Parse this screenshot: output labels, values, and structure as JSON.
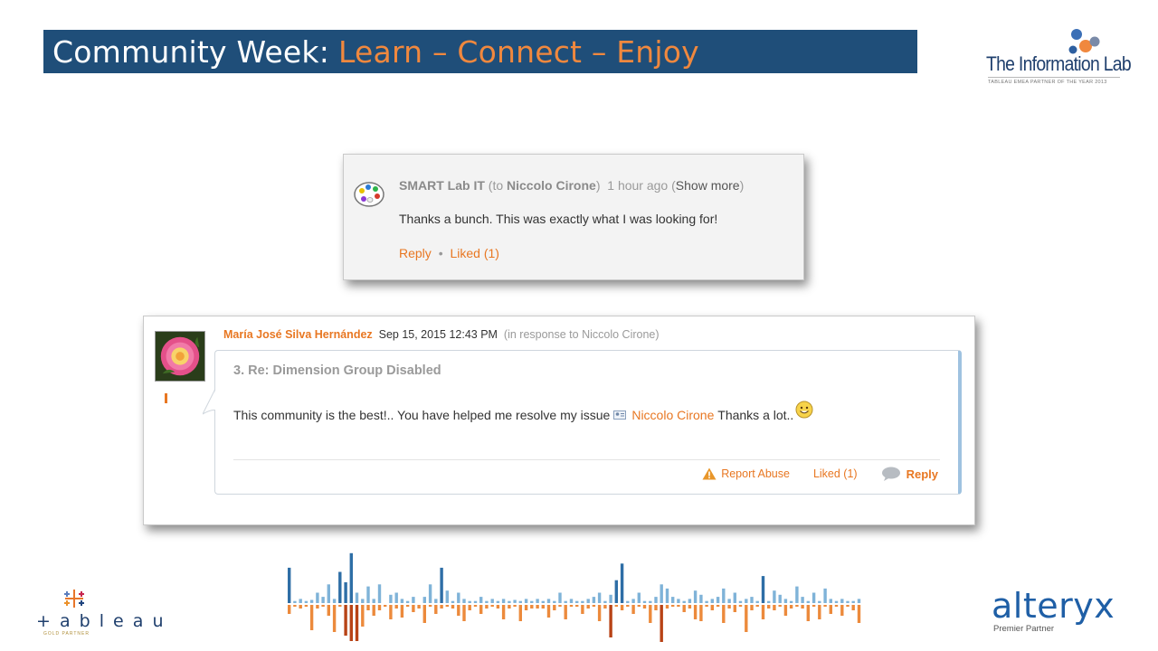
{
  "slide": {
    "title_main": "Community Week:",
    "title_accent": "Learn – Connect – Enjoy",
    "colors": {
      "banner": "#1f4e79",
      "accent": "#f0883e",
      "link": "#e87722"
    }
  },
  "logos": {
    "information_lab": {
      "name": "The Information Lab",
      "tagline": "TABLEAU EMEA PARTNER OF THE YEAR 2013"
    },
    "tableau": {
      "word": "+ a b l e a u",
      "sub": "GOLD PARTNER"
    },
    "alteryx": {
      "word": "alteryx",
      "sub": "Premier Partner"
    }
  },
  "comment1": {
    "author": "SMART Lab IT",
    "to_prefix": "(to",
    "to_name": "Niccolo Cirone",
    "to_suffix": ")",
    "time": "1 hour ago",
    "show_open": "(",
    "show_more": "Show more",
    "show_close": ")",
    "body": "Thanks a bunch. This was exactly what I was looking for!",
    "reply": "Reply",
    "separator": "•",
    "liked": "Liked (1)",
    "avatar_icon": "paint-palette-icon"
  },
  "comment2": {
    "author": "María José Silva Hernández",
    "datetime": "Sep 15, 2015 12:43 PM",
    "in_response": "(in response to Niccolo Cirone)",
    "subject": "3. Re: Dimension Group Disabled",
    "body_before": "This community is the best!.. You have helped me resolve my issue",
    "mention": "Niccolo Cirone",
    "body_after": "Thanks a lot..",
    "report": "Report Abuse",
    "liked": "Liked (1)",
    "reply": "Reply",
    "avatar_icon": "rose-photo",
    "emoji_icon": "smiley-icon"
  }
}
